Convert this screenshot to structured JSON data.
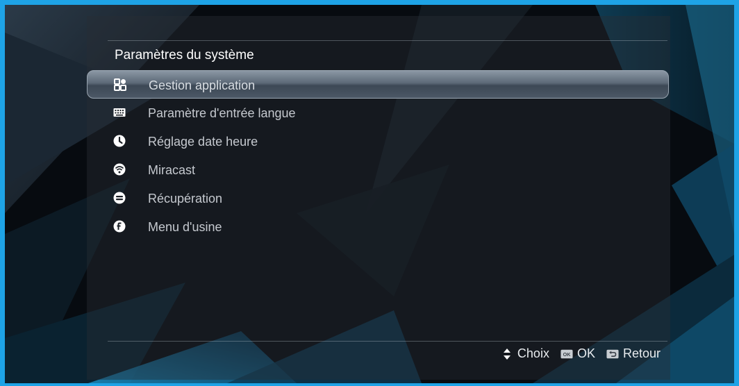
{
  "colors": {
    "accent_border": "#1ea3e6",
    "selection": "#5c6977",
    "text": "#c5c9cf"
  },
  "settings": {
    "title": "Paramètres du système",
    "items": [
      {
        "icon": "apps-grid-icon",
        "label": "Gestion application",
        "selected": true
      },
      {
        "icon": "keyboard-icon",
        "label": "Paramètre d'entrée langue"
      },
      {
        "icon": "clock-icon",
        "label": "Réglage date heure"
      },
      {
        "icon": "wifi-icon",
        "label": "Miracast"
      },
      {
        "icon": "restore-icon",
        "label": "Récupération"
      },
      {
        "icon": "factory-icon",
        "label": "Menu d'usine"
      }
    ]
  },
  "footer": {
    "choice_label": "Choix",
    "ok_label": "OK",
    "back_label": "Retour"
  }
}
